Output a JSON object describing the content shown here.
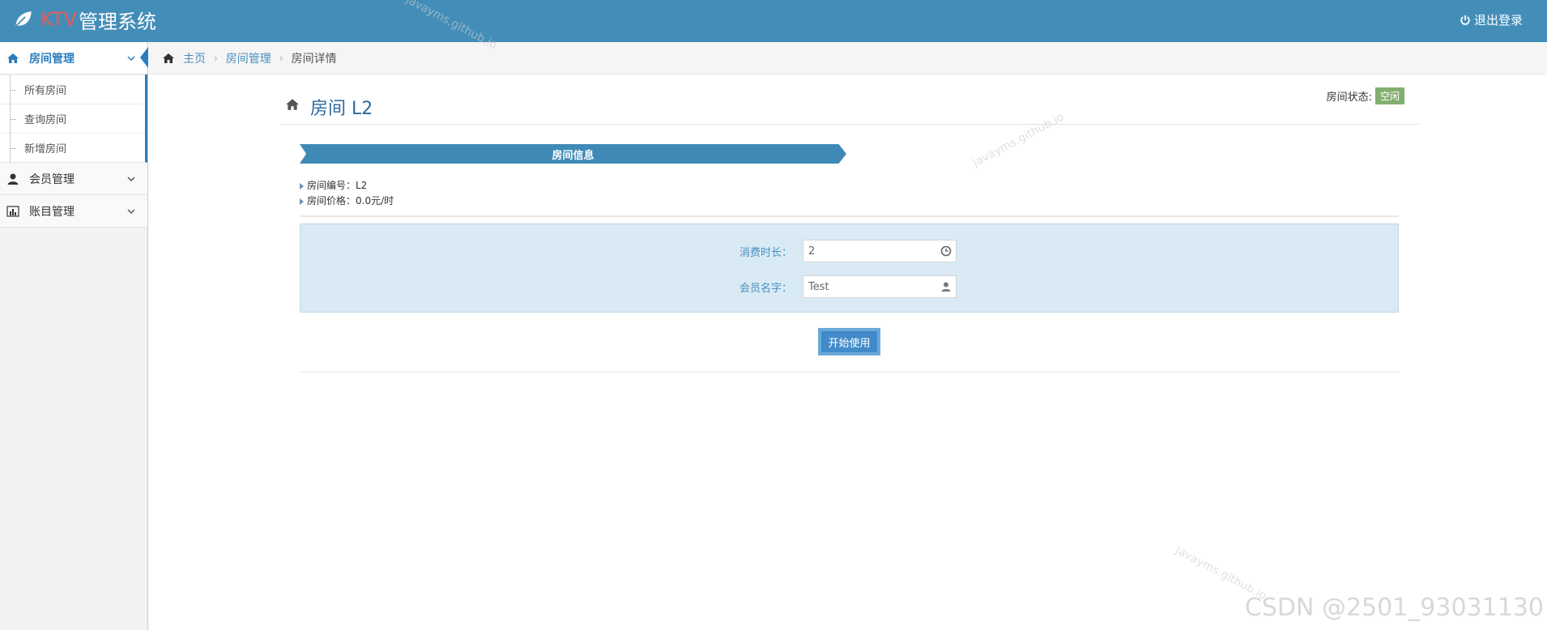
{
  "navbar": {
    "brand_ktv": "KTV",
    "brand_rest": "管理系统",
    "logout_label": "退出登录"
  },
  "sidebar": {
    "items": [
      {
        "label": "房间管理",
        "icon": "home-icon",
        "active": true,
        "children": [
          {
            "label": "所有房间"
          },
          {
            "label": "查询房间"
          },
          {
            "label": "新增房间"
          }
        ]
      },
      {
        "label": "会员管理",
        "icon": "user-icon",
        "active": false
      },
      {
        "label": "账目管理",
        "icon": "bar-chart-icon",
        "active": false
      }
    ]
  },
  "breadcrumb": {
    "home": "主页",
    "section": "房间管理",
    "current": "房间详情"
  },
  "page": {
    "title": "房间 L2",
    "status_label": "房间状态:",
    "status_value": "空闲",
    "ribbon": "房间信息",
    "info": [
      {
        "text": "房间编号：L2"
      },
      {
        "text": "房间价格：0.0元/时"
      }
    ]
  },
  "form": {
    "duration_label": "消费时长：",
    "duration_value": "2",
    "member_label": "会员名字：",
    "member_value": "Test",
    "submit_label": "开始使用"
  },
  "watermarks": {
    "site": "javayms.github.io",
    "csdn": "CSDN @2501_93031130"
  },
  "colors": {
    "navbar": "#438eb9",
    "brand_ktv": "#e85a5a",
    "status_badge": "#82af6f",
    "ribbon": "#3f89b6",
    "form_bg": "#d9eaf5"
  }
}
